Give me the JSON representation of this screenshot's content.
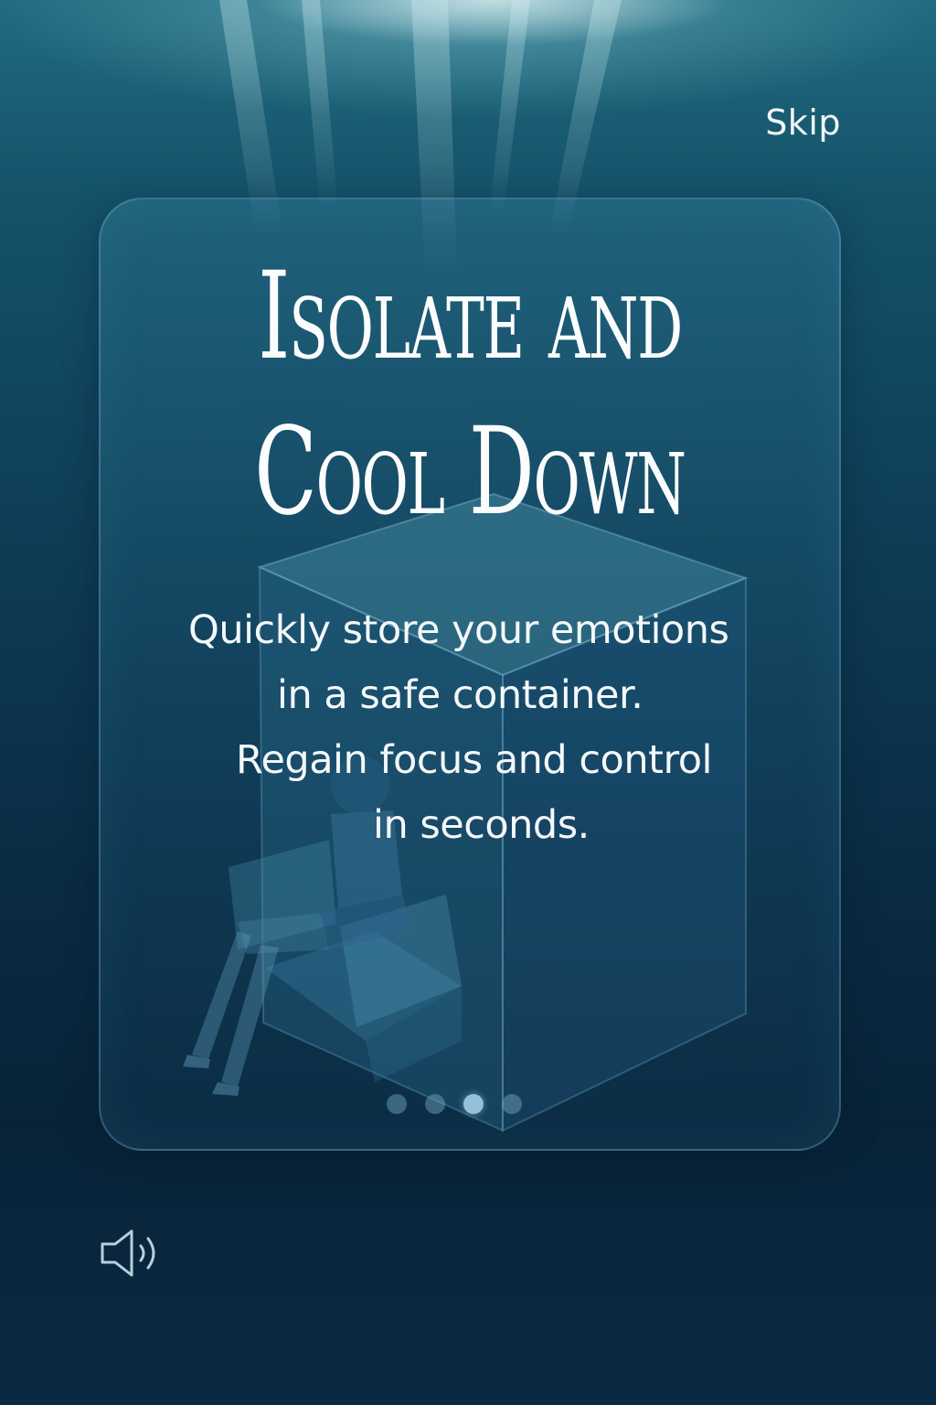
{
  "header": {
    "skip_label": "Skip"
  },
  "onboarding": {
    "title_line1": "Isolate and",
    "title_line2": "Cool Down",
    "description_lines": [
      "Quickly store your emotions",
      "in a safe container.",
      "Regain focus and control",
      "in seconds."
    ],
    "page_count": 4,
    "active_page": 3
  },
  "footer": {
    "sound_icon": "speaker-icon"
  },
  "colors": {
    "text": "#f4f8fa",
    "background_top": "#1f6b80",
    "background_bottom": "#082338",
    "dot_active": "#aad7f0",
    "dot_inactive": "#78aac8"
  }
}
